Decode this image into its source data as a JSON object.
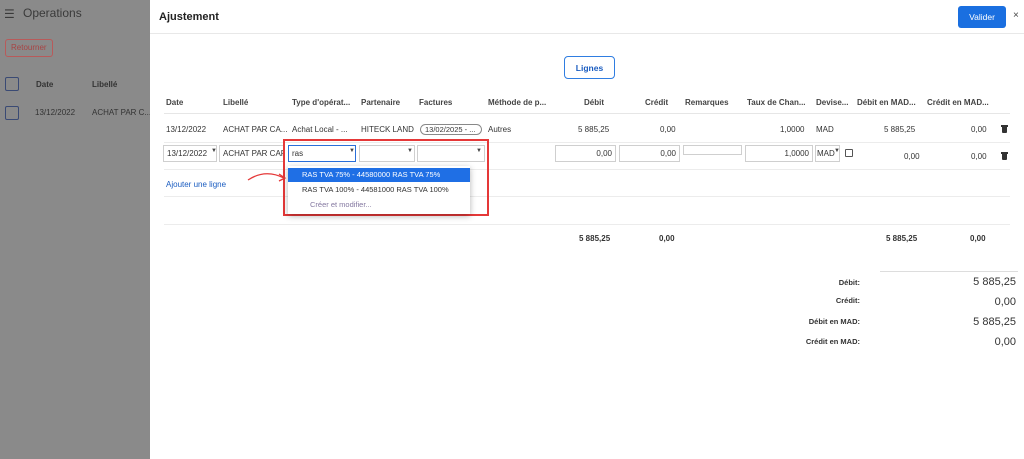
{
  "background": {
    "title": "Operations",
    "back_label": "Retourner",
    "columns": [
      "Date",
      "Libellé"
    ],
    "row": {
      "date": "13/12/2022",
      "label": "ACHAT PAR C..."
    }
  },
  "modal": {
    "title": "Ajustement",
    "validate_label": "Valider",
    "close_label": "×",
    "lines_button": "Lignes",
    "add_line": "Ajouter une ligne",
    "columns": {
      "date": "Date",
      "label": "Libellé",
      "op_type": "Type d'opérat...",
      "partner": "Partenaire",
      "invoices": "Factures",
      "method": "Méthode de p...",
      "debit": "Débit",
      "credit": "Crédit",
      "remarks": "Remarques",
      "rate": "Taux de Chan...",
      "currency": "Devise...",
      "debit_mad": "Débit en MAD...",
      "credit_mad": "Crédit en MAD..."
    },
    "row1": {
      "date": "13/12/2022",
      "label": "ACHAT PAR CA...",
      "op_type": "Achat Local - ...",
      "partner": "HITECK LAND",
      "invoice": "13/02/2025 - ...",
      "method": "Autres",
      "debit": "5 885,25",
      "credit": "0,00",
      "rate": "1,0000",
      "currency": "MAD",
      "debit_mad": "5 885,25",
      "credit_mad": "0,00"
    },
    "row2": {
      "date": "13/12/2022",
      "label": "ACHAT PAR CAR",
      "op_type_input": "ras",
      "debit": "0,00",
      "credit": "0,00",
      "rate": "1,0000",
      "currency": "MAD",
      "debit_mad": "0,00",
      "credit_mad": "0,00"
    },
    "dropdown": {
      "options": [
        "RAS TVA 75% - 44580000 RAS TVA 75%",
        "RAS TVA 100% - 44581000 RAS TVA 100%"
      ],
      "create": "Créer et modifier..."
    },
    "totals_row": {
      "debit": "5 885,25",
      "credit": "0,00",
      "debit_mad": "5 885,25",
      "credit_mad": "0,00"
    },
    "summary": {
      "debit_label": "Débit:",
      "debit_value": "5 885,25",
      "credit_label": "Crédit:",
      "credit_value": "0,00",
      "debit_mad_label": "Débit en MAD:",
      "debit_mad_value": "5 885,25",
      "credit_mad_label": "Crédit en MAD:",
      "credit_mad_value": "0,00"
    }
  },
  "colors": {
    "accent": "#1a6fe0",
    "highlight_box": "#e53838",
    "overlay": "#8a8a8a"
  }
}
